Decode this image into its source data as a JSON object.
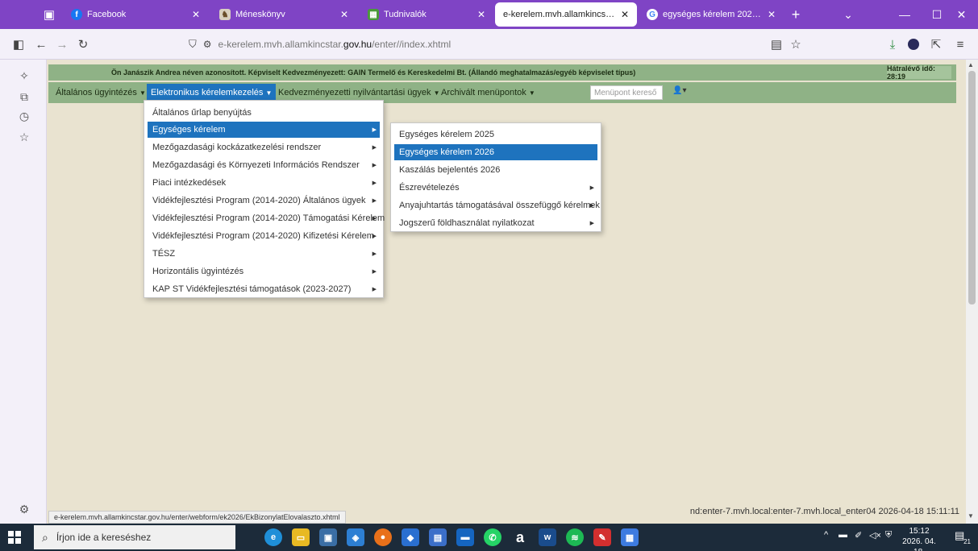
{
  "tabs": [
    {
      "title": "Facebook",
      "icon": "facebook-icon"
    },
    {
      "title": "Méneskönyv",
      "icon": "horse-icon"
    },
    {
      "title": "Tudnivalók",
      "icon": "grid-icon"
    },
    {
      "title": "e-kerelem.mvh.allamkincstar.gov.hu",
      "icon": "page-icon"
    },
    {
      "title": "egységes kérelem 2026 - Googl",
      "icon": "google-icon"
    }
  ],
  "url": {
    "prefix": "e-kerelem.mvh.allamkincstar.",
    "domain": "gov.hu",
    "path": "/enter//index.xhtml"
  },
  "infobar": {
    "message": "Ön Janászik Andrea néven azonosított.  Képviselt Kedvezményezett: GAIN Termelő és Kereskedelmi Bt. (Állandó meghatalmazás/egyéb képviselet típus)",
    "timer": "Hátralévő idő: 28:19"
  },
  "menu": {
    "items": [
      "Általános ügyintézés",
      "Elektronikus kérelemkezelés",
      "Kedvezményezetti nyilvántartási ügyek",
      "Archivált menüpontok"
    ],
    "search_placeholder": "Menüpont kereső"
  },
  "dropdown1": [
    "Általános űrlap benyújtás",
    "Egységes kérelem",
    "Mezőgazdasági kockázatkezelési rendszer",
    "Mezőgazdasági és Környezeti Információs Rendszer",
    "Piaci intézkedések",
    "Vidékfejlesztési Program (2014-2020) Általános ügyek",
    "Vidékfejlesztési Program (2014-2020) Támogatási Kérelem",
    "Vidékfejlesztési Program (2014-2020) Kifizetési Kérelem",
    "TÉSZ",
    "Horizontális ügyintézés",
    "KAP ST Vidékfejlesztési támogatások (2023-2027)"
  ],
  "dropdown2": [
    "Egységes kérelem 2025",
    "Egységes kérelem 2026",
    "Kaszálás bejelentés 2026",
    "Észrevételezés",
    "Anyajuhtartás támogatásával összefüggő kérelmek",
    "Jogszerű földhasználat nyilatkozat"
  ],
  "status_url": "e-kerelem.mvh.allamkincstar.gov.hu/enter/webform/ek2026/EkBizonylatElovalaszto.xhtml",
  "server_info": "nd:enter-7.mvh.local:enter-7.mvh.local_enter04   2026-04-18 15:11:11",
  "taskbar": {
    "search_placeholder": "Írjon ide a kereséshez",
    "time": "15:12",
    "date": "2026. 04. 18.",
    "notification_count": "21"
  },
  "colors": {
    "browser_purple": "#7f44c5",
    "menu_green": "#8fb286",
    "selection_blue": "#1e73be",
    "page_bg": "#e9e3d0"
  }
}
